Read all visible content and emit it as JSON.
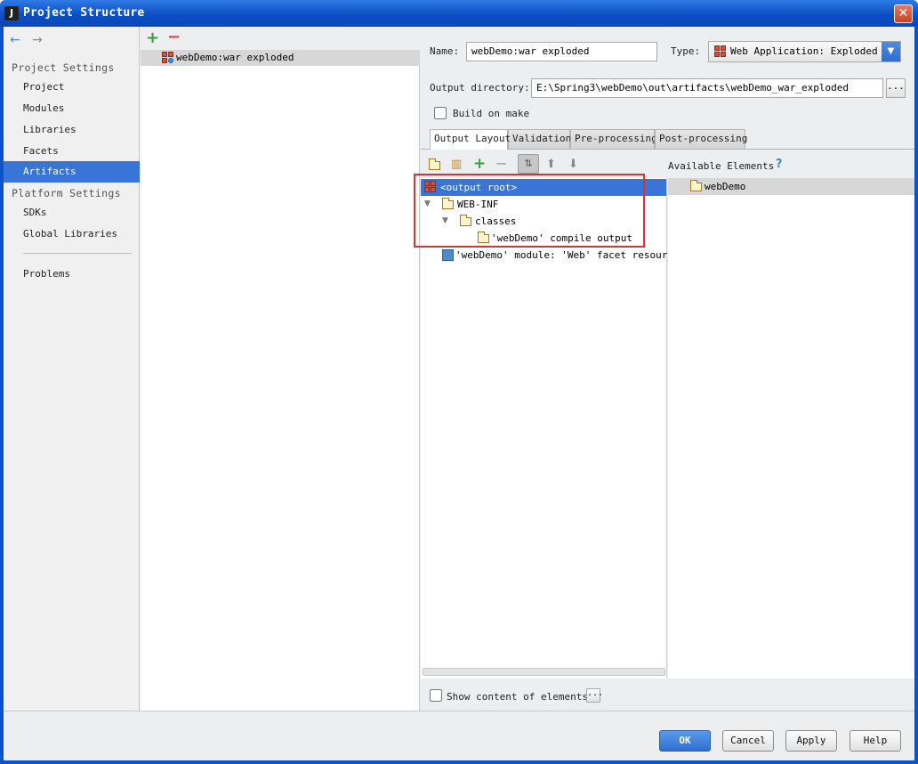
{
  "window": {
    "title": "Project Structure",
    "icon_letter": "J",
    "close_label": "✕"
  },
  "nav": {
    "back_icon": "←",
    "forward_icon": "→",
    "project_settings_heading": "Project Settings",
    "platform_settings_heading": "Platform Settings",
    "items": {
      "project": "Project",
      "modules": "Modules",
      "libraries": "Libraries",
      "facets": "Facets",
      "artifacts": "Artifacts",
      "sdks": "SDKs",
      "global_libraries": "Global Libraries",
      "problems": "Problems"
    },
    "selected": "Artifacts"
  },
  "artifact_list": {
    "add_label": "+",
    "remove_label": "−",
    "items": [
      "webDemo:war exploded"
    ]
  },
  "config": {
    "name_label": "Name:",
    "name_value": "webDemo:war exploded",
    "type_label": "Type:",
    "type_value": "Web Application: Exploded",
    "output_dir_label": "Output directory:",
    "output_dir_value": "E:\\Spring3\\webDemo\\out\\artifacts\\webDemo_war_exploded",
    "browse_label": "...",
    "build_on_make_label": "Build on make",
    "build_on_make_checked": false,
    "tabs": [
      "Output Layout",
      "Validation",
      "Pre-processing",
      "Post-processing"
    ],
    "selected_tab": "Output Layout",
    "available_elements_label": "Available Elements",
    "help_icon": "?",
    "tree": {
      "output_root": "<output root>",
      "web_inf": "WEB-INF",
      "classes": "classes",
      "compile_output": "'webDemo' compile output",
      "facet_resources": "'webDemo' module: 'Web' facet resources"
    },
    "available_items": [
      "webDemo"
    ],
    "show_content_label": "Show content of elements",
    "show_content_checked": false,
    "show_content_browse": "..."
  },
  "buttons": {
    "ok": "OK",
    "cancel": "Cancel",
    "apply": "Apply",
    "help": "Help"
  },
  "colors": {
    "selection": "#3875d7",
    "highlight_box": "#d5342f",
    "title_bar": "#0b4fc4"
  }
}
